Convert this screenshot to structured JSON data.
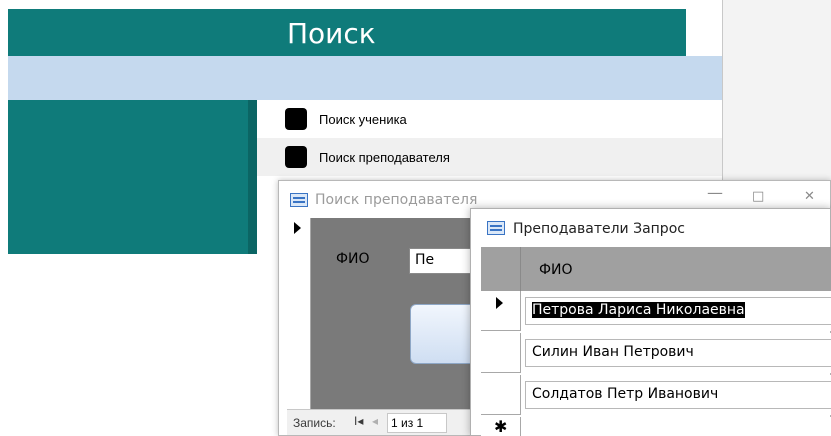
{
  "main_form": {
    "title": "Поиск",
    "nav_items": [
      {
        "label": "Поиск ученика"
      },
      {
        "label": "Поиск преподавателя"
      }
    ],
    "colors": {
      "header_teal": "#0f7b7a",
      "band_blue": "#c5d9ee"
    }
  },
  "search_window": {
    "title": "Поиск преподавателя",
    "controls": {
      "minimize": "—",
      "maximize": "□",
      "close": "✕"
    },
    "fio_label": "ФИО",
    "fio_value": "Пе",
    "record_nav": {
      "label": "Запись:",
      "first_glyph": "I◂",
      "prev_glyph": "◂",
      "position": "1 из 1"
    }
  },
  "query_window": {
    "title": "Преподаватели Запрос",
    "column_header": "ФИО",
    "rows": [
      "Петрова Лариса Николаевна",
      "Силин Иван Петрович",
      "Солдатов Петр Иванович"
    ],
    "new_row_marker": "✱"
  }
}
